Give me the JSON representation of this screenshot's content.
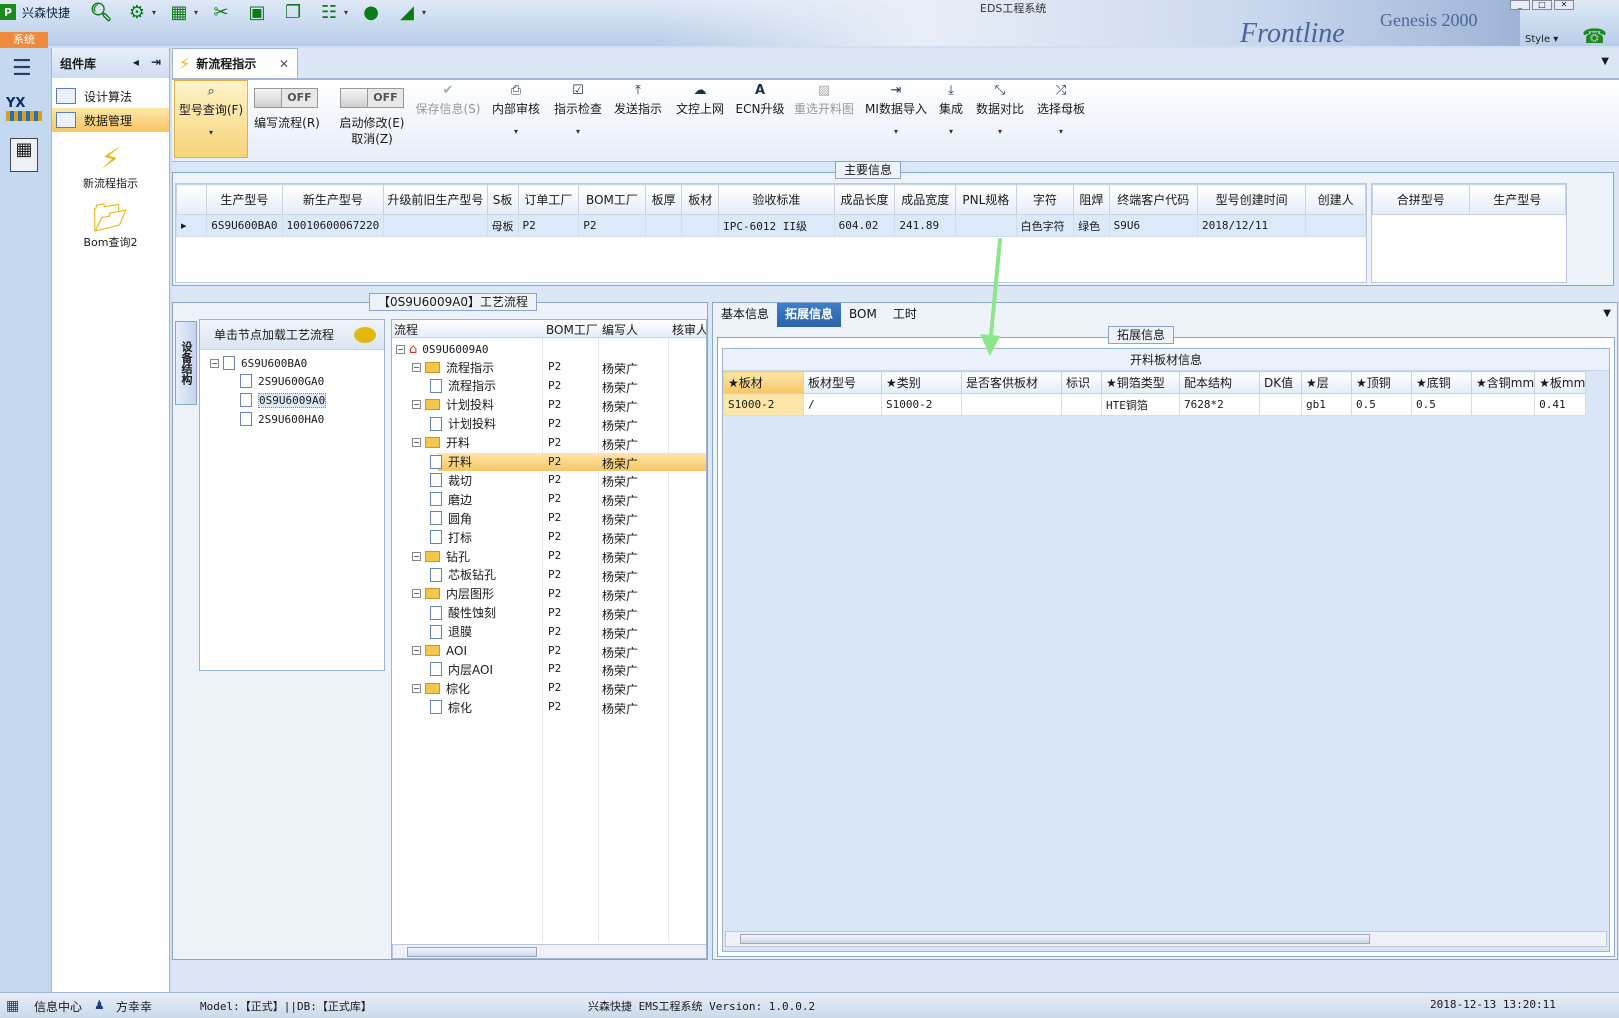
{
  "window": {
    "app_name": "兴森快捷",
    "banner_title": "EDS工程系统",
    "banner_brand": "Frontline",
    "banner_brand2": "Genesis 2000",
    "style_label": "Style",
    "system_tab": "系统"
  },
  "library": {
    "title": "组件库",
    "items": [
      {
        "label": "设计算法",
        "selected": false
      },
      {
        "label": "数据管理",
        "selected": true
      }
    ],
    "big_items": [
      {
        "label": "新流程指示",
        "icon": "lightning-icon"
      },
      {
        "label": "Bom查询2",
        "icon": "folder-icon"
      }
    ]
  },
  "doc_tab": {
    "label": "新流程指示"
  },
  "ribbon": {
    "query": "型号查询(F)",
    "toggle_off": "OFF",
    "write_flow": "编写流程(R)",
    "auto_modify": "启动修改(E)",
    "cancel": "取消(Z)",
    "save": "保存信息(S)",
    "internal_review": "内部审核",
    "instruction_check": "指示检查",
    "send_instruction": "发送指示",
    "file_upload": "文控上网",
    "ecn_upgrade": "ECN升级",
    "reselect_image": "重选开料图",
    "mi_import": "MI数据导入",
    "integrate": "集成",
    "compare": "数据对比",
    "select_master": "选择母板"
  },
  "main_info": {
    "title": "主要信息",
    "columns": [
      "生产型号",
      "新生产型号",
      "升级前旧生产型号",
      "S板",
      "订单工厂",
      "BOM工厂",
      "板厚",
      "板材",
      "验收标准",
      "成品长度",
      "成品宽度",
      "PNL规格",
      "字符",
      "阻焊",
      "终端客户代码",
      "型号创建时间",
      "创建人"
    ],
    "rows": [
      [
        "6S9U600BA0",
        "10010600067220",
        "",
        "母板",
        "P2",
        "P2",
        "",
        "",
        "IPC-6012 II级",
        "604.02",
        "241.89",
        "",
        "白色字符",
        "绿色",
        "S9U6",
        "2018/12/11",
        ""
      ]
    ],
    "side_columns": [
      "合拼型号",
      "生产型号"
    ]
  },
  "process": {
    "title": "【0S9U6009A0】工艺流程",
    "side_tab": "设备结构",
    "hint": "单击节点加载工艺流程",
    "model_tree": {
      "root": "6S9U600BA0",
      "children": [
        "2S9U600GA0",
        "0S9U6009A0",
        "2S9U600HA0"
      ],
      "selected": "0S9U6009A0"
    },
    "columns": [
      "流程",
      "BOM工厂",
      "编写人",
      "核审人"
    ],
    "root": "0S9U6009A0",
    "rows": [
      {
        "name": "流程指示",
        "level": 1,
        "folder": true,
        "factory": "P2",
        "writer": "杨荣广"
      },
      {
        "name": "流程指示",
        "level": 2,
        "folder": false,
        "factory": "P2",
        "writer": "杨荣广"
      },
      {
        "name": "计划投料",
        "level": 1,
        "folder": true,
        "factory": "P2",
        "writer": "杨荣广"
      },
      {
        "name": "计划投料",
        "level": 2,
        "folder": false,
        "factory": "P2",
        "writer": "杨荣广"
      },
      {
        "name": "开料",
        "level": 1,
        "folder": true,
        "factory": "P2",
        "writer": "杨荣广"
      },
      {
        "name": "开料",
        "level": 2,
        "folder": false,
        "factory": "P2",
        "writer": "杨荣广",
        "selected": true
      },
      {
        "name": "裁切",
        "level": 2,
        "folder": false,
        "factory": "P2",
        "writer": "杨荣广"
      },
      {
        "name": "磨边",
        "level": 2,
        "folder": false,
        "factory": "P2",
        "writer": "杨荣广"
      },
      {
        "name": "圆角",
        "level": 2,
        "folder": false,
        "factory": "P2",
        "writer": "杨荣广"
      },
      {
        "name": "打标",
        "level": 2,
        "folder": false,
        "factory": "P2",
        "writer": "杨荣广"
      },
      {
        "name": "钻孔",
        "level": 1,
        "folder": true,
        "factory": "P2",
        "writer": "杨荣广"
      },
      {
        "name": "芯板钻孔",
        "level": 2,
        "folder": false,
        "factory": "P2",
        "writer": "杨荣广"
      },
      {
        "name": "内层图形",
        "level": 1,
        "folder": true,
        "factory": "P2",
        "writer": "杨荣广"
      },
      {
        "name": "酸性蚀刻",
        "level": 2,
        "folder": false,
        "factory": "P2",
        "writer": "杨荣广"
      },
      {
        "name": "退膜",
        "level": 2,
        "folder": false,
        "factory": "P2",
        "writer": "杨荣广"
      },
      {
        "name": "AOI",
        "level": 1,
        "folder": true,
        "factory": "P2",
        "writer": "杨荣广"
      },
      {
        "name": "内层AOI",
        "level": 2,
        "folder": false,
        "factory": "P2",
        "writer": "杨荣广"
      },
      {
        "name": "棕化",
        "level": 1,
        "folder": true,
        "factory": "P2",
        "writer": "杨荣广"
      },
      {
        "name": "棕化",
        "level": 2,
        "folder": false,
        "factory": "P2",
        "writer": "杨荣广"
      }
    ]
  },
  "detail": {
    "tabs": [
      "基本信息",
      "拓展信息",
      "BOM",
      "工时"
    ],
    "active_tab": "拓展信息",
    "group_title": "拓展信息",
    "table_title": "开料板材信息",
    "columns": [
      "★板材",
      "板材型号",
      "★类别",
      "是否客供板材",
      "标识",
      "★铜箔类型",
      "配本结构",
      "DK值",
      "★层",
      "★顶铜",
      "★底铜",
      "★含铜mm",
      "★板mm"
    ],
    "rows": [
      [
        "S1000-2",
        "/",
        "S1000-2",
        "",
        "",
        "HTE铜箔",
        "7628*2",
        "",
        "gb1",
        "0.5",
        "0.5",
        "",
        "0.41"
      ]
    ]
  },
  "status": {
    "info_center": "信息中心",
    "user": "方幸幸",
    "model": "Model:【正式】||DB:【正式库】",
    "version": "兴森快捷 EMS工程系统 Version: 1.0.0.2",
    "datetime": "2018-12-13 13:20:11"
  },
  "colors": {
    "accent": "#f7c566",
    "selection": "#dbe9fb",
    "annotation_arrow": "#8ce68c"
  }
}
